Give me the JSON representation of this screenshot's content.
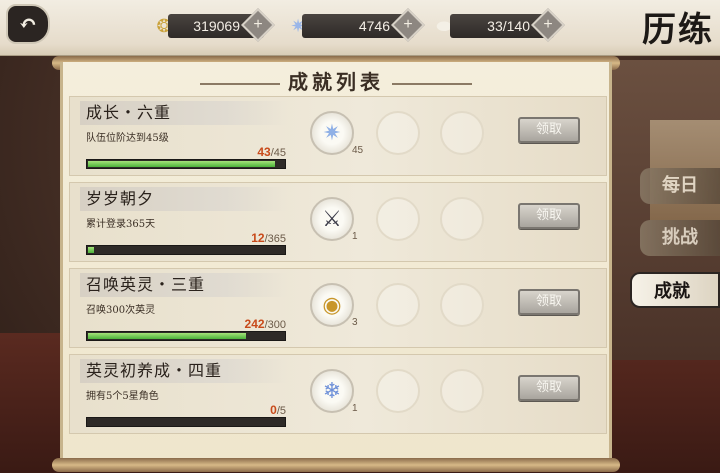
{
  "header": {
    "title": "历练",
    "back_icon": "back-arrow-icon",
    "resources": [
      {
        "icon": "coin-cluster-icon",
        "value": "319069"
      },
      {
        "icon": "crystal-star-icon",
        "value": "4746"
      },
      {
        "icon": "stone-icon",
        "value": "33/140"
      }
    ],
    "plus": "+"
  },
  "panel": {
    "title": "成就列表"
  },
  "achievements": [
    {
      "name": "成长・六重",
      "desc": "队伍位阶达到45级",
      "current": "43",
      "total": "/45",
      "progress": 0.956,
      "reward_icon": "crystal-star-icon",
      "reward_qty": "45",
      "claim": "领取"
    },
    {
      "name": "岁岁朝夕",
      "desc": "累计登录365天",
      "current": "12",
      "total": "/365",
      "progress": 0.033,
      "reward_icon": "weapon-icon",
      "reward_qty": "1",
      "claim": "领取"
    },
    {
      "name": "召唤英灵・三重",
      "desc": "召唤300次英灵",
      "current": "242",
      "total": "/300",
      "progress": 0.807,
      "reward_icon": "gold-orb-icon",
      "reward_qty": "3",
      "claim": "领取"
    },
    {
      "name": "英灵初养成・四重",
      "desc": "拥有5个5星角色",
      "current": "0",
      "total": "/5",
      "progress": 0.0,
      "reward_icon": "ice-crystal-icon",
      "reward_qty": "1",
      "claim": "领取"
    }
  ],
  "tabs": [
    {
      "label": "每日",
      "active": false
    },
    {
      "label": "挑战",
      "active": false
    },
    {
      "label": "成就",
      "active": true
    }
  ]
}
